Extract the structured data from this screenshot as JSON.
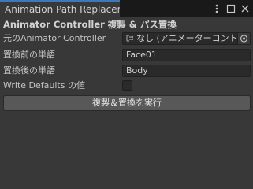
{
  "window": {
    "tab_title": "Animation Path Replacer",
    "more_icon": "kebab-menu-icon",
    "maximize_icon": "maximize-icon",
    "close_icon": "close-icon"
  },
  "panel": {
    "header": "Animator Controller 複製 & パス置換",
    "source_controller": {
      "label": "元のAnimator Controller",
      "value": "なし (アニメーターコントローラー)",
      "icon": "animator-controller-icon",
      "picker_icon": "object-picker-icon"
    },
    "before_word": {
      "label": "置換前の単語",
      "value": "Face01"
    },
    "after_word": {
      "label": "置換後の単語",
      "value": "Body"
    },
    "write_defaults": {
      "label": "Write Defaults の値",
      "checked": false
    },
    "execute_button": "複製＆置換を実行"
  }
}
